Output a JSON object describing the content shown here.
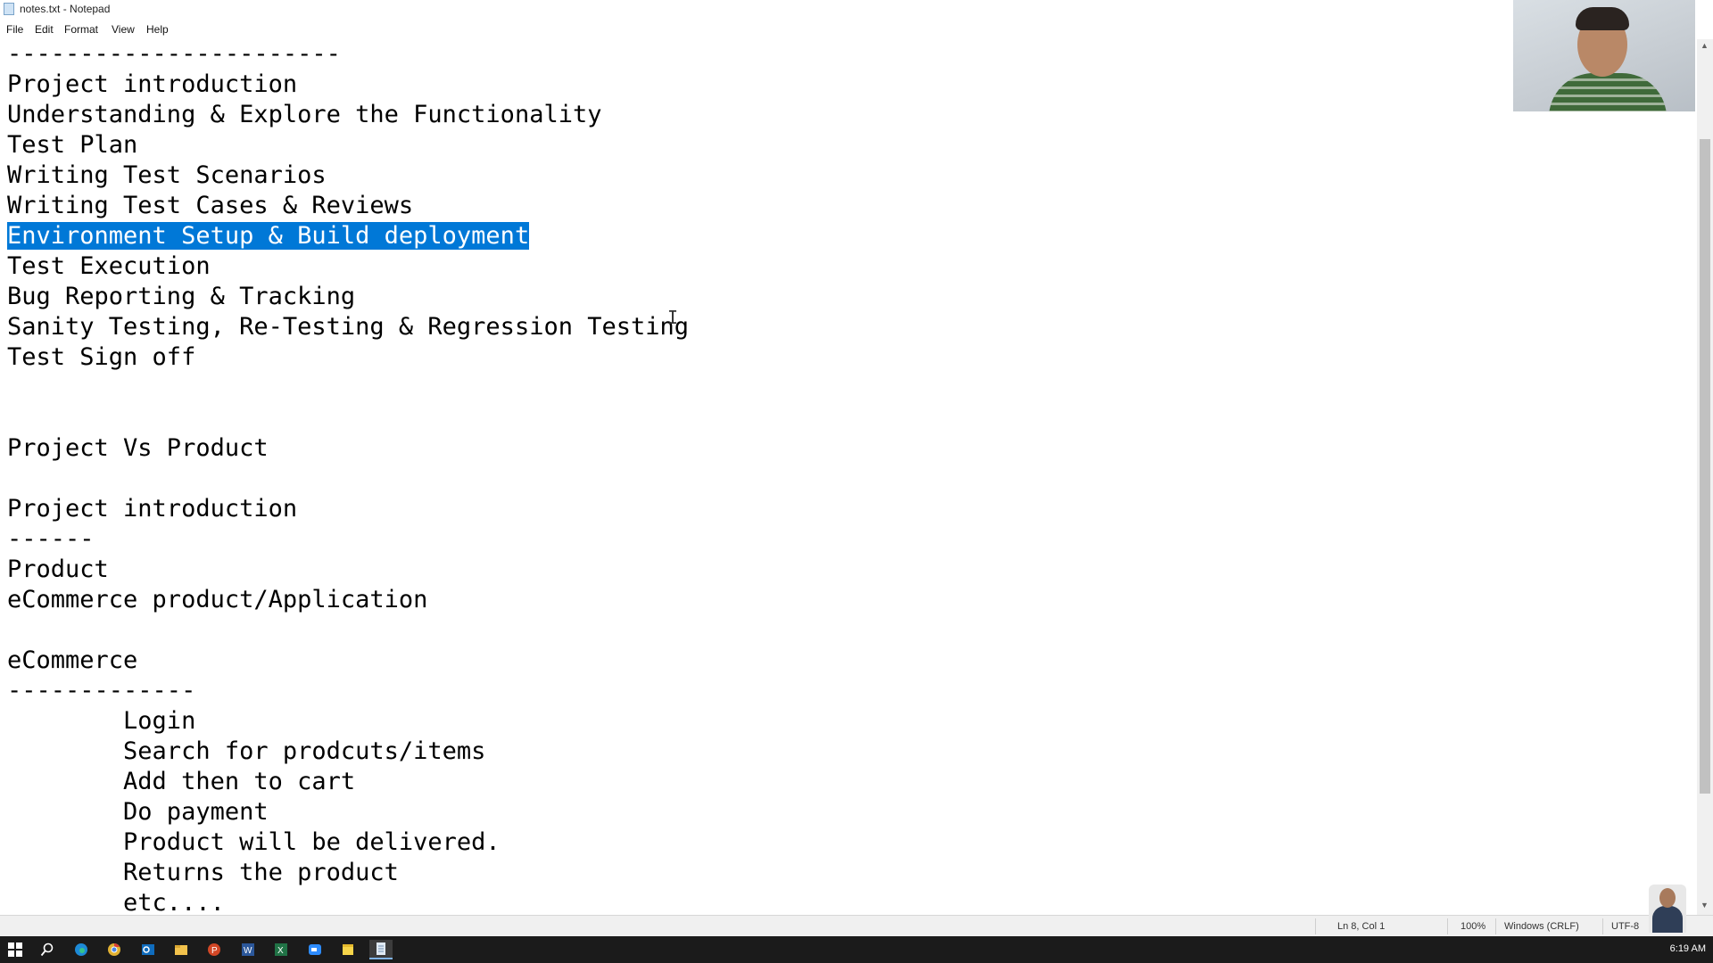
{
  "window": {
    "title": "notes.txt - Notepad"
  },
  "menu": [
    "File",
    "Edit",
    "Format",
    "View",
    "Help"
  ],
  "editor": {
    "lines": [
      "-----------------------",
      "Project introduction",
      "Understanding & Explore the Functionality",
      "Test Plan",
      "Writing Test Scenarios",
      "Writing Test Cases & Reviews",
      "Environment Setup & Build deployment",
      "Test Execution",
      "Bug Reporting & Tracking",
      "Sanity Testing, Re-Testing & Regression Testing",
      "Test Sign off",
      "",
      "",
      "Project Vs Product",
      "",
      "Project introduction",
      "------",
      "Product",
      "eCommerce product/Application",
      "",
      "eCommerce",
      "-------------",
      "        Login",
      "        Search for prodcuts/items",
      "        Add then to cart",
      "        Do payment",
      "        Product will be delivered.",
      "        Returns the product",
      "        etc...."
    ],
    "selected_line": "Environment Setup & Build deployment"
  },
  "statusbar": {
    "position": "Ln 8, Col 1",
    "zoom": "100%",
    "line_ending": "Windows (CRLF)",
    "encoding": "UTF-8"
  },
  "taskbar": {
    "icons": [
      "windows-start-icon",
      "search-icon",
      "edge-icon",
      "chrome-icon",
      "outlook-icon",
      "file-explorer-icon",
      "powerpoint-icon",
      "word-icon",
      "excel-icon",
      "zoom-icon",
      "sticky-notes-icon",
      "notepad-icon"
    ],
    "time": "6:19 AM"
  },
  "colors": {
    "selection": "#0078d7",
    "taskbar": "#1b1b1b",
    "statusbar": "#f0f0f0"
  }
}
